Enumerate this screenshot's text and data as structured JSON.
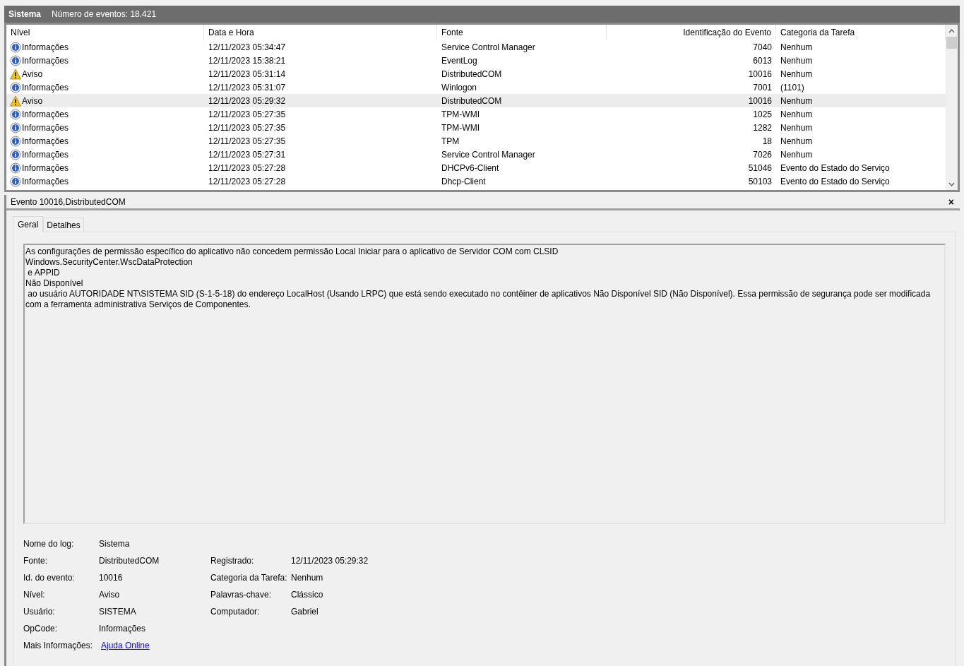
{
  "header": {
    "log_name": "Sistema",
    "event_count": "Número de eventos: 18.421"
  },
  "table": {
    "columns": [
      "Nível",
      "Data e Hora",
      "Fonte",
      "Identificação do Evento",
      "Categoria da Tarefa"
    ],
    "rows": [
      {
        "kind": "info",
        "level": "Informações",
        "date": "12/11/2023 05:34:47",
        "source": "Service Control Manager",
        "event_id": "7040",
        "category": "Nenhum",
        "selected": false
      },
      {
        "kind": "info",
        "level": "Informações",
        "date": "12/11/2023 15:38:21",
        "source": "EventLog",
        "event_id": "6013",
        "category": "Nenhum",
        "selected": false
      },
      {
        "kind": "warning",
        "level": "Aviso",
        "date": "12/11/2023 05:31:14",
        "source": "DistributedCOM",
        "event_id": "10016",
        "category": "Nenhum",
        "selected": false
      },
      {
        "kind": "info",
        "level": "Informações",
        "date": "12/11/2023 05:31:07",
        "source": "Winlogon",
        "event_id": "7001",
        "category": "(1101)",
        "selected": false
      },
      {
        "kind": "warning",
        "level": "Aviso",
        "date": "12/11/2023 05:29:32",
        "source": "DistributedCOM",
        "event_id": "10016",
        "category": "Nenhum",
        "selected": true
      },
      {
        "kind": "info",
        "level": "Informações",
        "date": "12/11/2023 05:27:35",
        "source": "TPM-WMI",
        "event_id": "1025",
        "category": "Nenhum",
        "selected": false
      },
      {
        "kind": "info",
        "level": "Informações",
        "date": "12/11/2023 05:27:35",
        "source": "TPM-WMI",
        "event_id": "1282",
        "category": "Nenhum",
        "selected": false
      },
      {
        "kind": "info",
        "level": "Informações",
        "date": "12/11/2023 05:27:35",
        "source": "TPM",
        "event_id": "18",
        "category": "Nenhum",
        "selected": false
      },
      {
        "kind": "info",
        "level": "Informações",
        "date": "12/11/2023 05:27:31",
        "source": "Service Control Manager",
        "event_id": "7026",
        "category": "Nenhum",
        "selected": false
      },
      {
        "kind": "info",
        "level": "Informações",
        "date": "12/11/2023 05:27:28",
        "source": "DHCPv6-Client",
        "event_id": "51046",
        "category": "Evento do Estado do Serviço",
        "selected": false
      },
      {
        "kind": "info",
        "level": "Informações",
        "date": "12/11/2023 05:27:28",
        "source": "Dhcp-Client",
        "event_id": "50103",
        "category": "Evento do Estado do Serviço",
        "selected": false
      }
    ]
  },
  "detail": {
    "title": "Evento 10016,DistributedCOM",
    "close": "×",
    "tabs": [
      {
        "label": "Geral",
        "selected": true
      },
      {
        "label": "Detalhes",
        "selected": false
      }
    ],
    "description": "As configurações de permissão específico do aplicativo não concedem permissão Local Iniciar para o aplicativo de Servidor COM com CLSID \nWindows.SecurityCenter.WscDataProtection\n e APPID \nNão Disponível\n ao usuário AUTORIDADE NT\\SISTEMA SID (S-1-5-18) do endereço LocalHost (Usando LRPC) que está sendo executado no contêiner de aplicativos Não Disponível SID (Não Disponível). Essa permissão de segurança pode ser modificada com a ferramenta administrativa Serviços de Componentes.",
    "properties": [
      {
        "left": {
          "label": "Nome do log:",
          "value": "Sistema",
          "kind": "text"
        }
      },
      {
        "left": {
          "label": "Fonte:",
          "value": "DistributedCOM",
          "kind": "text"
        },
        "right": {
          "label": "Registrado:",
          "value": "12/11/2023 05:29:32"
        }
      },
      {
        "left": {
          "label": "Id. do evento:",
          "value": "10016",
          "kind": "text"
        },
        "right": {
          "label": "Categoria da Tarefa:",
          "value": "Nenhum"
        }
      },
      {
        "left": {
          "label": "Nível:",
          "value": "Aviso",
          "kind": "text"
        },
        "right": {
          "label": "Palavras-chave:",
          "value": "Clássico"
        }
      },
      {
        "left": {
          "label": "Usuário:",
          "value": "SISTEMA",
          "kind": "text"
        },
        "right": {
          "label": "Computador:",
          "value": "Gabriel"
        }
      },
      {
        "left": {
          "label": "OpCode:",
          "value": "Informações",
          "kind": "text"
        }
      },
      {
        "left": {
          "label": "Mais Informações:",
          "value": "Ajuda Online",
          "kind": "link"
        }
      }
    ]
  }
}
